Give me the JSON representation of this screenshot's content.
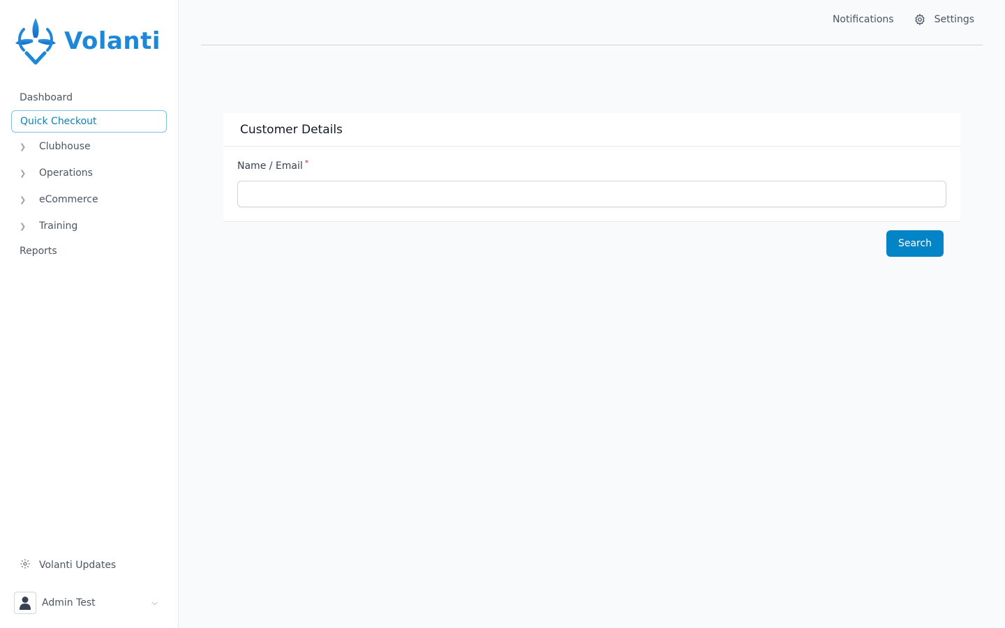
{
  "brand": {
    "name": "Volanti",
    "color": "#1e88d8"
  },
  "sidebar": {
    "items": [
      {
        "label": "Dashboard",
        "type": "link"
      },
      {
        "label": "Quick Checkout",
        "type": "link",
        "active": true
      },
      {
        "label": "Clubhouse",
        "type": "group",
        "icon": "chevron-right-icon"
      },
      {
        "label": "Operations",
        "type": "group",
        "icon": "chevron-right-icon"
      },
      {
        "label": "eCommerce",
        "type": "group",
        "icon": "chevron-right-icon"
      },
      {
        "label": "Training",
        "type": "group",
        "icon": "chevron-right-icon"
      },
      {
        "label": "Reports",
        "type": "link"
      }
    ],
    "updates": {
      "label": "Volanti Updates",
      "icon": "gear-icon"
    },
    "user": {
      "name": "Admin Test",
      "icon": "user-icon"
    }
  },
  "topbar": {
    "notifications_label": "Notifications",
    "settings_label": "Settings"
  },
  "card": {
    "title": "Customer Details",
    "field_label": "Name / Email",
    "required_mark": "*",
    "field_value": "",
    "search_label": "Search"
  },
  "colors": {
    "accent": "#0284c7",
    "active_border": "#7cc4e6",
    "required": "#dc2626"
  }
}
